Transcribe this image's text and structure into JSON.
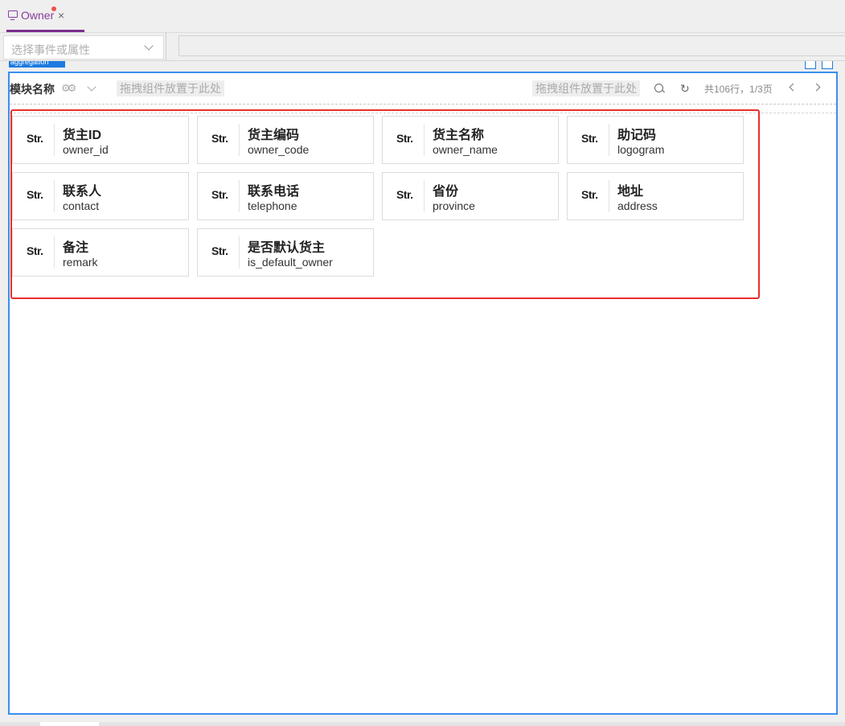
{
  "tab": {
    "label": "Owner",
    "close": "×"
  },
  "event_bar": {
    "placeholder": "选择事件或属性"
  },
  "component_tag": "aggregation",
  "panel": {
    "module_name": "模块名称",
    "drop_left": "拖拽组件放置于此处",
    "drop_right": "拖拽组件放置于此处",
    "pager": "共106行，1/3页"
  },
  "fields": [
    {
      "type": "Str.",
      "name": "货主ID",
      "key": "owner_id"
    },
    {
      "type": "Str.",
      "name": "货主编码",
      "key": "owner_code"
    },
    {
      "type": "Str.",
      "name": "货主名称",
      "key": "owner_name"
    },
    {
      "type": "Str.",
      "name": "助记码",
      "key": "logogram"
    },
    {
      "type": "Str.",
      "name": "联系人",
      "key": "contact"
    },
    {
      "type": "Str.",
      "name": "联系电话",
      "key": "telephone"
    },
    {
      "type": "Str.",
      "name": "省份",
      "key": "province"
    },
    {
      "type": "Str.",
      "name": "地址",
      "key": "address"
    },
    {
      "type": "Str.",
      "name": "备注",
      "key": "remark"
    },
    {
      "type": "Str.",
      "name": "是否默认货主",
      "key": "is_default_owner"
    }
  ],
  "colors": {
    "accent": "#7a2e8e",
    "selection": "#3a8ef0",
    "highlight": "#e8302a"
  }
}
